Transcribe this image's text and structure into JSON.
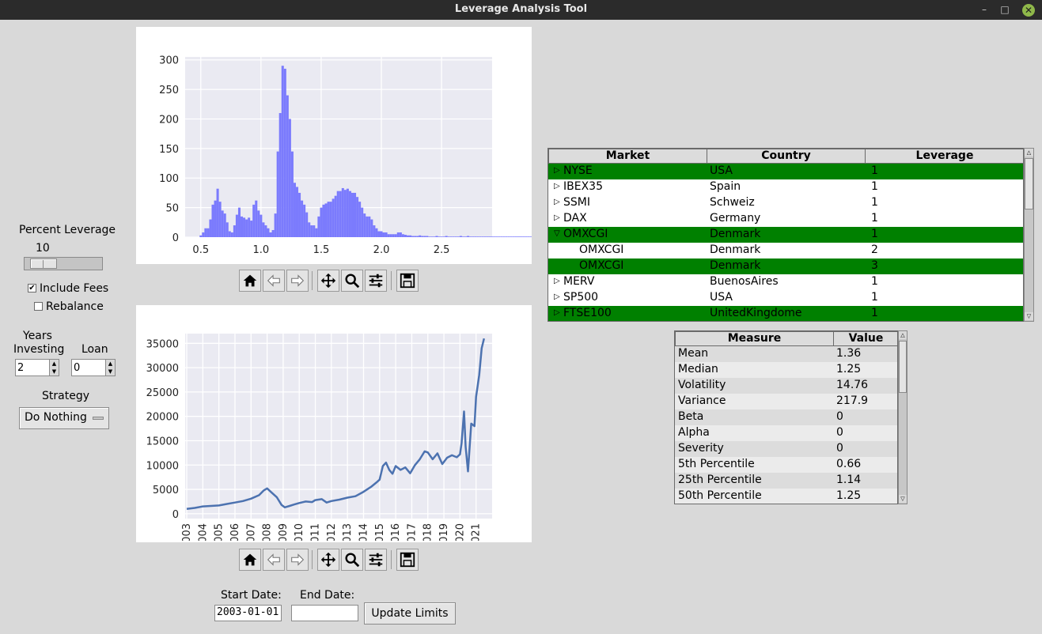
{
  "window": {
    "title": "Leverage Analysis Tool",
    "buttons": [
      "–",
      "□",
      "✕"
    ]
  },
  "controls": {
    "percent_leverage_label": "Percent Leverage",
    "percent_leverage_value": "10",
    "percent_leverage_slider_fraction": 0.1,
    "include_fees_label": "Include Fees",
    "include_fees_checked": true,
    "rebalance_label": "Rebalance",
    "rebalance_checked": false,
    "years_label_1": "Years",
    "years_label_2": "Investing",
    "years_value": "2",
    "loan_label": "Loan",
    "loan_value": "0",
    "strategy_label": "Strategy",
    "strategy_value": "Do Nothing"
  },
  "histogram": {
    "chart_data": {
      "type": "bar",
      "title": "",
      "xlabel": "",
      "ylabel": "",
      "xlim": [
        0.37,
        2.92
      ],
      "ylim": [
        0,
        305
      ],
      "xticks": [
        "0.5",
        "1.0",
        "1.5",
        "2.0",
        "2.5"
      ],
      "xtick_values": [
        0.5,
        1.0,
        1.5,
        2.0,
        2.5
      ],
      "yticks": [
        "0",
        "50",
        "100",
        "150",
        "200",
        "250",
        "300"
      ],
      "ytick_values": [
        0,
        50,
        100,
        150,
        200,
        250,
        300
      ],
      "bin_start": 0.49,
      "bin_width": 0.02,
      "values": [
        3,
        8,
        15,
        15,
        30,
        55,
        62,
        82,
        60,
        45,
        40,
        25,
        10,
        8,
        20,
        38,
        50,
        35,
        33,
        30,
        33,
        28,
        55,
        62,
        45,
        38,
        25,
        20,
        15,
        8,
        12,
        40,
        145,
        210,
        290,
        285,
        240,
        200,
        145,
        92,
        85,
        75,
        62,
        55,
        42,
        25,
        20,
        20,
        15,
        35,
        50,
        55,
        57,
        60,
        60,
        65,
        70,
        78,
        78,
        83,
        80,
        82,
        78,
        75,
        75,
        68,
        60,
        50,
        40,
        35,
        35,
        30,
        20,
        15,
        10,
        10,
        8,
        8,
        5,
        5,
        5,
        5,
        8,
        8,
        5,
        4,
        3,
        3,
        2,
        2,
        2,
        3,
        2,
        2,
        2,
        1,
        1,
        1,
        2,
        1,
        1,
        1,
        2,
        1,
        1,
        1,
        1,
        1,
        2,
        1,
        1,
        2,
        1,
        1,
        1,
        1,
        1,
        1,
        1,
        1,
        1,
        1,
        1,
        1,
        1,
        1,
        1,
        1,
        1,
        1,
        1,
        1,
        1,
        1,
        1,
        1,
        1,
        1,
        1,
        1,
        1,
        1,
        1,
        1,
        1,
        1,
        1,
        1,
        1,
        1,
        1
      ],
      "color": "#7b7bfd",
      "background": "#eaeaf2"
    }
  },
  "timeseries": {
    "chart_data": {
      "type": "line",
      "title": "",
      "xlabel": "",
      "ylabel": "",
      "xlim": [
        2002.9,
        2022.0
      ],
      "ylim": [
        -1000,
        37000
      ],
      "xticks": [
        "2003",
        "2004",
        "2005",
        "2006",
        "2007",
        "2008",
        "2009",
        "2010",
        "2011",
        "2012",
        "2013",
        "2014",
        "2015",
        "2016",
        "2017",
        "2018",
        "2019",
        "2020",
        "2021"
      ],
      "xtick_values": [
        2003,
        2004,
        2005,
        2006,
        2007,
        2008,
        2009,
        2010,
        2011,
        2012,
        2013,
        2014,
        2015,
        2016,
        2017,
        2018,
        2019,
        2020,
        2021
      ],
      "yticks": [
        "0",
        "5000",
        "10000",
        "15000",
        "20000",
        "25000",
        "30000",
        "35000"
      ],
      "ytick_values": [
        0,
        5000,
        10000,
        15000,
        20000,
        25000,
        30000,
        35000
      ],
      "x": [
        2003.0,
        2003.5,
        2004.0,
        2004.5,
        2005.0,
        2005.5,
        2006.0,
        2006.5,
        2007.0,
        2007.5,
        2007.8,
        2008.0,
        2008.3,
        2008.6,
        2008.9,
        2009.1,
        2009.4,
        2009.7,
        2010.0,
        2010.4,
        2010.8,
        2011.0,
        2011.4,
        2011.7,
        2012.0,
        2012.5,
        2013.0,
        2013.5,
        2014.0,
        2014.5,
        2014.8,
        2015.0,
        2015.2,
        2015.4,
        2015.6,
        2015.8,
        2016.0,
        2016.3,
        2016.6,
        2016.9,
        2017.2,
        2017.5,
        2017.8,
        2018.0,
        2018.3,
        2018.6,
        2018.9,
        2019.2,
        2019.5,
        2019.8,
        2020.0,
        2020.1,
        2020.25,
        2020.35,
        2020.5,
        2020.7,
        2020.9,
        2021.0,
        2021.2,
        2021.35,
        2021.5
      ],
      "y": [
        1000,
        1200,
        1500,
        1600,
        1700,
        2000,
        2300,
        2600,
        3100,
        3800,
        4800,
        5200,
        4300,
        3400,
        1800,
        1300,
        1600,
        1900,
        2200,
        2500,
        2400,
        2800,
        3000,
        2300,
        2600,
        2900,
        3300,
        3600,
        4500,
        5600,
        6400,
        7000,
        9800,
        10500,
        9000,
        8200,
        9800,
        9000,
        9500,
        8300,
        10000,
        11200,
        12800,
        12600,
        11200,
        12400,
        10200,
        11500,
        12000,
        11600,
        12200,
        14500,
        21000,
        13800,
        8700,
        18500,
        18000,
        24000,
        28500,
        34000,
        36000
      ],
      "color": "#4c72b0",
      "background": "#eaeaf2"
    }
  },
  "date_controls": {
    "start_label": "Start Date:",
    "end_label": "End Date:",
    "start_value": "2003-01-01",
    "end_value": "",
    "update_button": "Update Limits"
  },
  "market_table": {
    "columns": [
      "Market",
      "Country",
      "Leverage"
    ],
    "rows": [
      {
        "market": "NYSE",
        "country": "USA",
        "leverage": "1",
        "selected": true,
        "expander": "closed",
        "child": false
      },
      {
        "market": "IBEX35",
        "country": "Spain",
        "leverage": "1",
        "selected": false,
        "expander": "closed",
        "child": false
      },
      {
        "market": "SSMI",
        "country": "Schweiz",
        "leverage": "1",
        "selected": false,
        "expander": "closed",
        "child": false
      },
      {
        "market": "DAX",
        "country": "Germany",
        "leverage": "1",
        "selected": false,
        "expander": "closed",
        "child": false
      },
      {
        "market": "OMXCGI",
        "country": "Denmark",
        "leverage": "1",
        "selected": true,
        "expander": "open",
        "child": false
      },
      {
        "market": "OMXCGI",
        "country": "Denmark",
        "leverage": "2",
        "selected": false,
        "expander": "none",
        "child": true
      },
      {
        "market": "OMXCGI",
        "country": "Denmark",
        "leverage": "3",
        "selected": true,
        "expander": "none",
        "child": true
      },
      {
        "market": "MERV",
        "country": "BuenosAires",
        "leverage": "1",
        "selected": false,
        "expander": "closed",
        "child": false
      },
      {
        "market": "SP500",
        "country": "USA",
        "leverage": "1",
        "selected": false,
        "expander": "closed",
        "child": false
      },
      {
        "market": "FTSE100",
        "country": "UnitedKingdome",
        "leverage": "1",
        "selected": true,
        "expander": "closed",
        "child": false
      }
    ],
    "selected_color": "#008000"
  },
  "stats_table": {
    "columns": [
      "Measure",
      "Value"
    ],
    "rows": [
      {
        "measure": "Mean",
        "value": "1.36"
      },
      {
        "measure": "Median",
        "value": "1.25"
      },
      {
        "measure": "Volatility",
        "value": "14.76"
      },
      {
        "measure": "Variance",
        "value": "217.9"
      },
      {
        "measure": "Beta",
        "value": "0"
      },
      {
        "measure": "Alpha",
        "value": "0"
      },
      {
        "measure": "Severity",
        "value": "0"
      },
      {
        "measure": "5th Percentile",
        "value": "0.66"
      },
      {
        "measure": "25th Percentile",
        "value": "1.14"
      },
      {
        "measure": "50th Percentile",
        "value": "1.25"
      }
    ]
  },
  "toolbar_icons": [
    "home-icon",
    "back-icon",
    "forward-icon",
    "pan-icon",
    "zoom-icon",
    "configure-subplots-icon",
    "save-icon"
  ]
}
